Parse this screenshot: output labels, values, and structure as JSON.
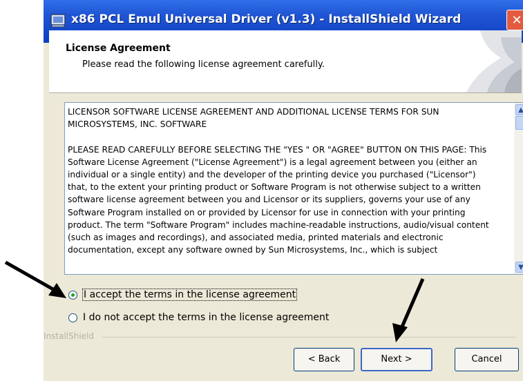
{
  "window": {
    "title": "x86 PCL Emul Universal Driver (v1.3) - InstallShield Wizard",
    "close_label": "✕"
  },
  "header": {
    "title": "License Agreement",
    "subtitle": "Please read the following license agreement carefully."
  },
  "license": {
    "text": "LICENSOR SOFTWARE LICENSE AGREEMENT AND ADDITIONAL LICENSE TERMS FOR SUN MICROSYSTEMS, INC. SOFTWARE\n\nPLEASE READ CAREFULLY BEFORE SELECTING THE \"YES \" OR \"AGREE\" BUTTON ON THIS PAGE: This Software License Agreement (\"License Agreement\") is a legal agreement between you (either an individual or a single entity) and the developer of the printing device you purchased (\"Licensor\") that, to the extent your printing product or Software Program is not otherwise subject to a written software license agreement between you and Licensor or its suppliers, governs your use of any Software Program installed on or provided by Licensor for use in connection with your printing product. The term \"Software Program\" includes machine-readable instructions, audio/visual content (such as images and recordings), and associated media, printed materials and electronic documentation, except any software owned by Sun Microsystems, Inc., which is subject"
  },
  "options": {
    "accept_label": "I accept the terms in the license agreement",
    "decline_label": "I do not accept the terms in the license agreement",
    "selected": "accept"
  },
  "brand": {
    "label": "InstallShield"
  },
  "buttons": {
    "back_label": "< Back",
    "next_label": "Next >",
    "cancel_label": "Cancel"
  },
  "colors": {
    "titlebar": "#0f3fc0",
    "dialog_bg": "#ece9d8",
    "close_button": "#e35b3f",
    "radio_dot": "#21a121"
  }
}
